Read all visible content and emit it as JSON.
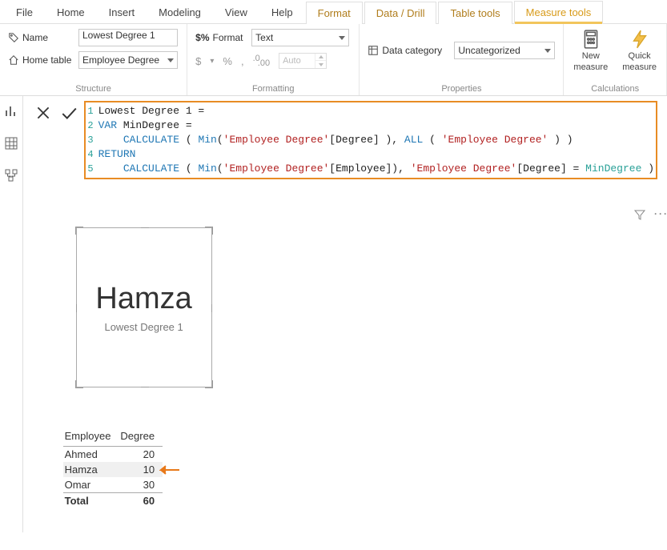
{
  "tabs": {
    "file": "File",
    "home": "Home",
    "insert": "Insert",
    "modeling": "Modeling",
    "view": "View",
    "help": "Help",
    "format": "Format",
    "datadrill": "Data / Drill",
    "tabletools": "Table tools",
    "measuretools": "Measure tools"
  },
  "ribbon": {
    "structure": {
      "title": "Structure",
      "name_label": "Name",
      "name_value": "Lowest Degree 1",
      "home_label": "Home table",
      "home_value": "Employee Degree"
    },
    "formatting": {
      "title": "Formatting",
      "format_label": "Format",
      "format_value": "Text",
      "currency": "$",
      "percent": "%",
      "comma": ",",
      "decimals": ".00",
      "auto": "Auto"
    },
    "properties": {
      "title": "Properties",
      "datacat_label": "Data category",
      "datacat_value": "Uncategorized"
    },
    "calc": {
      "title": "Calculations",
      "newmeasure_l1": "New",
      "newmeasure_l2": "measure",
      "quickmeasure_l1": "Quick",
      "quickmeasure_l2": "measure"
    }
  },
  "formula": {
    "lines": {
      "n1": "1",
      "t1a": "Lowest Degree 1 = ",
      "n2": "2",
      "t2a": "VAR",
      "t2b": " MinDegree",
      "t2c": " = ",
      "n3": "3",
      "t3a": "    ",
      "t3b": "CALCULATE",
      "t3c": " ( ",
      "t3d": "Min",
      "t3e": "(",
      "t3f": "'Employee Degree'",
      "t3g": "[Degree] ), ",
      "t3h": "ALL",
      "t3i": " ( ",
      "t3j": "'Employee Degree'",
      "t3k": " ) )",
      "n4": "4",
      "t4a": "RETURN",
      "n5": "5",
      "t5a": "    ",
      "t5b": "CALCULATE",
      "t5c": " ( ",
      "t5d": "Min",
      "t5e": "(",
      "t5f": "'Employee Degree'",
      "t5g": "[Employee]), ",
      "t5h": "'Employee Degree'",
      "t5i": "[Degree] = ",
      "t5j": "MinDegree",
      "t5k": " )"
    }
  },
  "card": {
    "value": "Hamza",
    "caption": "Lowest Degree 1"
  },
  "table": {
    "headers": {
      "employee": "Employee",
      "degree": "Degree"
    },
    "rows": {
      "r0e": "Ahmed",
      "r0d": "20",
      "r1e": "Hamza",
      "r1d": "10",
      "r2e": "Omar",
      "r2d": "30"
    },
    "total_label": "Total",
    "total_value": "60"
  },
  "chart_data": [
    {
      "type": "table",
      "title": "Employee Degree",
      "columns": [
        "Employee",
        "Degree"
      ],
      "rows": [
        [
          "Ahmed",
          20
        ],
        [
          "Hamza",
          10
        ],
        [
          "Omar",
          30
        ]
      ],
      "totals": {
        "Degree": 60
      },
      "highlight_row_index": 1
    },
    {
      "type": "card",
      "title": "Lowest Degree 1",
      "value": "Hamza"
    }
  ]
}
